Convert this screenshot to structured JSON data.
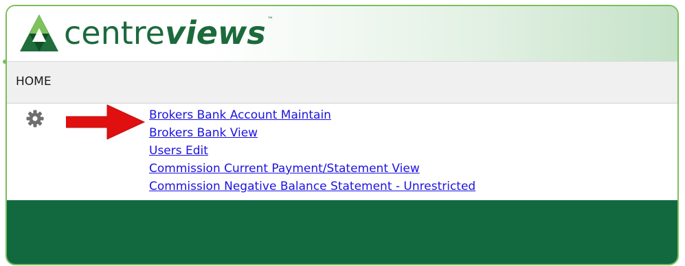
{
  "brand": {
    "name_light": "centre",
    "name_bold": "views",
    "trademark": "™",
    "colors": {
      "primary_green": "#1c6a3c",
      "light_green": "#79bf5a",
      "footer_green": "#126940",
      "link_blue": "#1b12e0",
      "arrow_red": "#e01010"
    }
  },
  "nav": {
    "home_label": "HOME"
  },
  "icons": {
    "settings": "gear-icon",
    "pointer": "red-arrow-icon"
  },
  "links": [
    {
      "label": "Brokers Bank Account Maintain"
    },
    {
      "label": "Brokers Bank View"
    },
    {
      "label": "Users Edit"
    },
    {
      "label": "Commission Current Payment/Statement View"
    },
    {
      "label": "Commission Negative Balance Statement - Unrestricted"
    }
  ]
}
